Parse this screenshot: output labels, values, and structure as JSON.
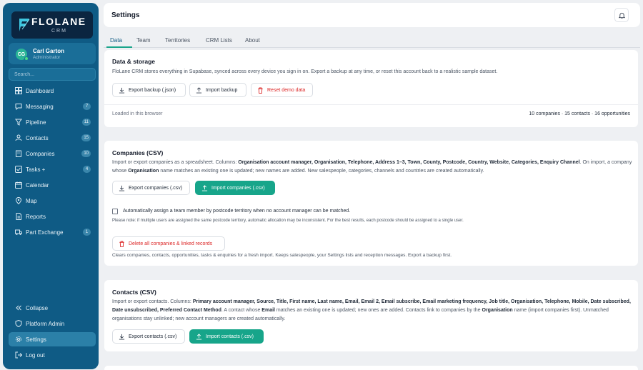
{
  "brand": {
    "name": "FLOLANE",
    "sub": "CRM"
  },
  "user": {
    "initials": "CG",
    "name": "Carl Garton",
    "role": "Administrator"
  },
  "search": {
    "placeholder": "Search..."
  },
  "nav": [
    {
      "label": "Dashboard",
      "icon": "dashboard-icon"
    },
    {
      "label": "Messaging",
      "icon": "messaging-icon",
      "badge": "7"
    },
    {
      "label": "Pipeline",
      "icon": "pipeline-icon",
      "badge": "11"
    },
    {
      "label": "Contacts",
      "icon": "contacts-icon",
      "badge": "15"
    },
    {
      "label": "Companies",
      "icon": "companies-icon",
      "badge": "10"
    },
    {
      "label": "Tasks +",
      "icon": "tasks-icon",
      "badge": "4"
    },
    {
      "label": "Calendar",
      "icon": "calendar-icon"
    },
    {
      "label": "Map",
      "icon": "map-icon"
    },
    {
      "label": "Reports",
      "icon": "reports-icon"
    },
    {
      "label": "Part Exchange",
      "icon": "truck-icon",
      "badge": "1"
    }
  ],
  "nav_bottom": [
    {
      "label": "Collapse",
      "icon": "collapse-icon"
    },
    {
      "label": "Platform Admin",
      "icon": "shield-icon"
    },
    {
      "label": "Settings",
      "icon": "gear-icon",
      "active": true
    },
    {
      "label": "Log out",
      "icon": "logout-icon"
    }
  ],
  "header": {
    "title": "Settings"
  },
  "tabs": [
    "Data",
    "Team",
    "Territories",
    "CRM Lists",
    "About"
  ],
  "storage": {
    "title": "Data & storage",
    "desc": "FloLane CRM stores everything in Supabase, synced across every device you sign in on. Export a backup at any time, or reset this account back to a realistic sample dataset.",
    "export_label": "Export backup (.json)",
    "import_label": "Import backup",
    "reset_label": "Reset demo data",
    "loaded_text": "Loaded in this browser",
    "counts_text": "10 companies · 15 contacts · 16 opportunities"
  },
  "companies": {
    "title": "Companies (CSV)",
    "desc_1": "Import or export companies as a spreadsheet. Columns: ",
    "columns": "Organisation account manager, Organisation, Telephone, Address 1–3, Town, County, Postcode, Country, Website, Categories, Enquiry Channel",
    "desc_2": ". On import, a company whose ",
    "key_field": "Organisation",
    "desc_3": " name matches an existing one is updated; new names are added. New salespeople, categories, channels and countries are created automatically.",
    "export_label": "Export companies (.csv)",
    "import_label": "Import companies (.csv)",
    "auto_assign_label": "Automatically assign a team member by postcode territory when no account manager can be matched.",
    "auto_assign_checked": false,
    "note": "Please note: if multiple users are assigned the same postcode territory, automatic allocation may be inconsistent. For the best results, each postcode should be assigned to a single user.",
    "delete_label": "Delete all companies & linked records",
    "delete_desc": "Clears companies, contacts, opportunities, tasks & enquiries for a fresh import. Keeps salespeople, your Settings lists and reception messages. Export a backup first."
  },
  "contacts": {
    "title": "Contacts (CSV)",
    "desc_1": "Import or export contacts. Columns: ",
    "columns": "Primary account manager, Source, Title, First name, Last name, Email, Email 2, Email subscribe, Email marketing frequency, Job title, Organisation, Telephone, Mobile, Date subscribed, Date unsubscribed, Preferred Contact Method",
    "desc_2": ". A contact whose ",
    "key_field": "Email",
    "desc_3": " matches an existing one is updated; new ones are added. Contacts link to companies by the ",
    "link_field": "Organisation",
    "desc_4": " name (import companies first). Unmatched organisations stay unlinked; new account managers are created automatically.",
    "export_label": "Export contacts (.csv)",
    "import_label": "Import contacts (.csv)"
  },
  "colors": {
    "sidebar": "#0f5b85",
    "accent": "#17a58a",
    "danger": "#dc2626"
  }
}
